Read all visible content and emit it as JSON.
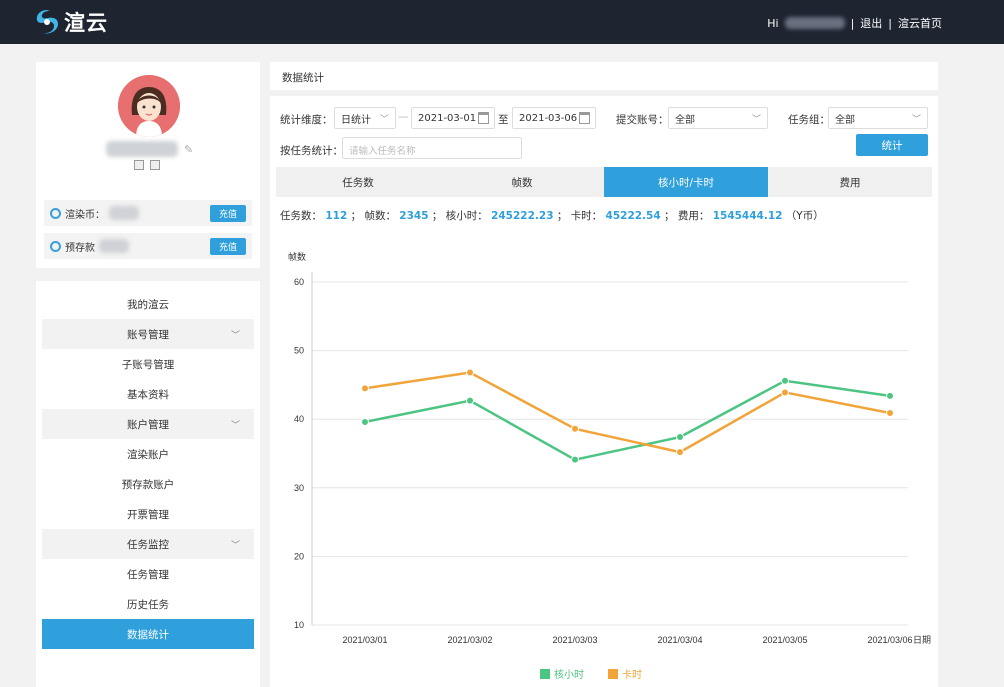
{
  "header": {
    "logo_text": "渲云",
    "greeting": "Hi",
    "logout": "退出",
    "home": "渲云首页"
  },
  "profile": {
    "balances": [
      {
        "label": "渲染币：",
        "button": "充值"
      },
      {
        "label": "预存款",
        "button": "充值"
      }
    ]
  },
  "menu": {
    "items": [
      {
        "label": "我的渲云",
        "type": "item"
      },
      {
        "label": "账号管理",
        "type": "group"
      },
      {
        "label": "子账号管理",
        "type": "item"
      },
      {
        "label": "基本资料",
        "type": "item"
      },
      {
        "label": "账户管理",
        "type": "group"
      },
      {
        "label": "渲染账户",
        "type": "item"
      },
      {
        "label": "预存款账户",
        "type": "item"
      },
      {
        "label": "开票管理",
        "type": "item"
      },
      {
        "label": "任务监控",
        "type": "group"
      },
      {
        "label": "任务管理",
        "type": "item"
      },
      {
        "label": "历史任务",
        "type": "item"
      },
      {
        "label": "数据统计",
        "type": "active"
      }
    ]
  },
  "breadcrumb": "数据统计",
  "filters": {
    "dimension_label": "统计维度：",
    "dimension_value": "日统计",
    "date_from": "2021-03-01",
    "date_sep": "至",
    "date_to": "2021-03-06",
    "account_label": "提交账号：",
    "account_value": "全部",
    "group_label": "任务组：",
    "group_value": "全部",
    "task_label": "按任务统计：",
    "task_placeholder": "请输入任务名称",
    "stat_button": "统计"
  },
  "tabs": [
    "任务数",
    "帧数",
    "核小时/卡时",
    "费用"
  ],
  "active_tab": 2,
  "summary": {
    "tasks_label": "任务数：",
    "tasks": "112",
    "frames_label": "帧数：",
    "frames": "2345",
    "core_label": "核小时：",
    "core": "245222.23",
    "card_label": "卡时：",
    "card": "45222.54",
    "cost_label": "费用：",
    "cost": "1545444.12",
    "cost_unit": "（Y币）"
  },
  "chart_data": {
    "type": "line",
    "ylabel": "帧数",
    "xlabel": "日期",
    "categories": [
      "2021/03/01",
      "2021/03/02",
      "2021/03/03",
      "2021/03/04",
      "2021/03/05",
      "2021/03/06"
    ],
    "ylim": [
      10,
      60
    ],
    "yticks": [
      10,
      20,
      30,
      40,
      50,
      60
    ],
    "grid": true,
    "legend": "bottom",
    "series": [
      {
        "name": "核小时",
        "color": "#4cc482",
        "values": [
          39.6,
          42.7,
          34.1,
          37.4,
          45.6,
          43.4
        ]
      },
      {
        "name": "卡时",
        "color": "#f0a43a",
        "values": [
          44.5,
          46.8,
          38.6,
          35.2,
          43.9,
          40.9
        ]
      }
    ]
  }
}
